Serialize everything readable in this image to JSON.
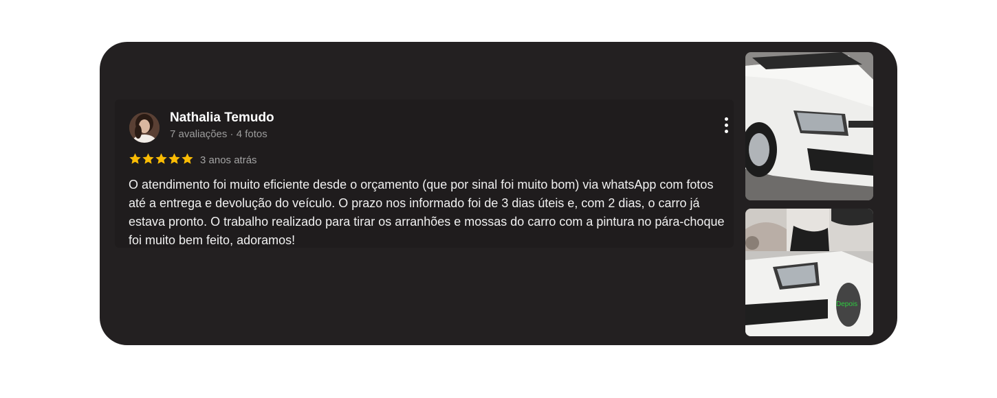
{
  "review": {
    "author": {
      "name": "Nathalia Temudo",
      "meta": "7 avaliações · 4 fotos",
      "avatar_icon": "profile-photo"
    },
    "rating": 5,
    "rating_color": "#fbbc04",
    "time_ago": "3 anos atrás",
    "text": "O atendimento foi muito eficiente desde o orçamento (que por sinal foi muito bom) via whatsApp com fotos até a entrega e devolução do veículo. O prazo nos informado foi de 3 dias úteis e, com 2 dias, o carro já estava pronto. O trabalho realizado para tirar os arranhões e mossas do carro com a pintura no pára-choque foi muito bem feito, adoramos!",
    "menu_icon": "more-vert-icon",
    "photos": [
      {
        "subject": "white-car-front"
      },
      {
        "subject": "before-after-collage",
        "overlay_label": "Depois",
        "overlay_color": "#2ecc40"
      }
    ]
  }
}
